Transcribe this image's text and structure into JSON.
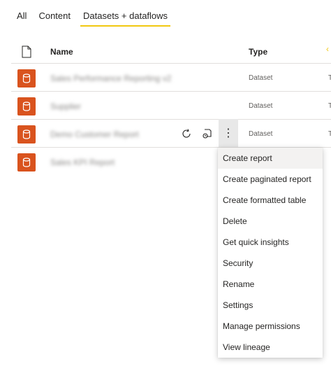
{
  "tabs": [
    {
      "label": "All"
    },
    {
      "label": "Content"
    },
    {
      "label": "Datasets + dataflows"
    }
  ],
  "table": {
    "columns": {
      "name": "Name",
      "type": "Type"
    },
    "rows": [
      {
        "name": "Sales Performance Reporting v2",
        "type": "Dataset",
        "tail": "T"
      },
      {
        "name": "Supplier",
        "type": "Dataset",
        "tail": "T"
      },
      {
        "name": "Demo Customer Report",
        "type": "Dataset",
        "tail": "T"
      },
      {
        "name": "Sales KPI Report",
        "type": "",
        "tail": ""
      }
    ]
  },
  "context_menu": {
    "items": [
      {
        "label": "Create report"
      },
      {
        "label": "Create paginated report"
      },
      {
        "label": "Create formatted table"
      },
      {
        "label": "Delete"
      },
      {
        "label": "Get quick insights"
      },
      {
        "label": "Security"
      },
      {
        "label": "Rename"
      },
      {
        "label": "Settings"
      },
      {
        "label": "Manage permissions"
      },
      {
        "label": "View lineage"
      }
    ]
  },
  "colors": {
    "accent": "#f2c811",
    "dataset_icon": "#d9531e"
  },
  "icons": {
    "header": "file-icon",
    "row": "dataset-cylinder-icon",
    "refresh": "refresh-icon",
    "schedule": "schedule-refresh-icon",
    "more": "more-options-icon"
  }
}
